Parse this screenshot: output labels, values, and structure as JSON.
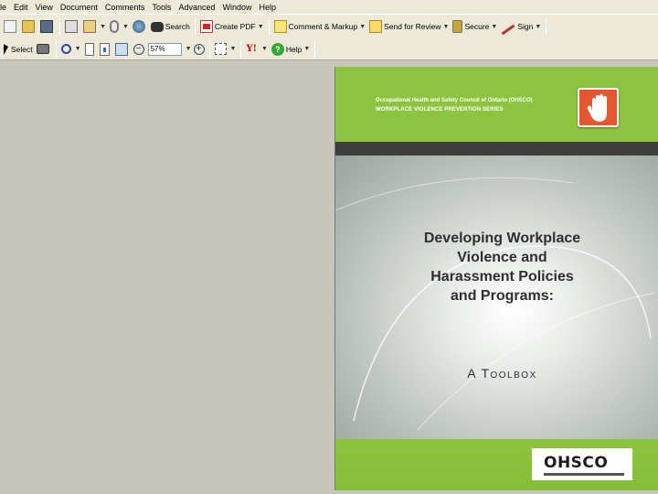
{
  "menu": [
    "ile",
    "Edit",
    "View",
    "Document",
    "Comments",
    "Tools",
    "Advanced",
    "Window",
    "Help"
  ],
  "toolbar1": {
    "search_label": "Search",
    "create_pdf_label": "Create PDF",
    "comment_markup_label": "Comment & Markup",
    "send_review_label": "Send for Review",
    "secure_label": "Secure",
    "sign_label": "Sign"
  },
  "toolbar2": {
    "select_label": "Select",
    "zoom_value": "57%",
    "help_label": "Help"
  },
  "cover": {
    "council": "Occupational Health and Safety Council of Ontario (OHSCO)",
    "series": "WORKPLACE VIOLENCE PREVENTION SERIES",
    "title_lines": [
      "Developing Workplace",
      "Violence and",
      "Harassment Policies",
      "and Programs:"
    ],
    "subtitle": "A Toolbox",
    "logo": "OHSCO"
  },
  "colors": {
    "chrome": "#ece9d8",
    "workspace": "#c8c6bb",
    "brand_green": "#8cc43f",
    "badge_red": "#e5552e"
  }
}
